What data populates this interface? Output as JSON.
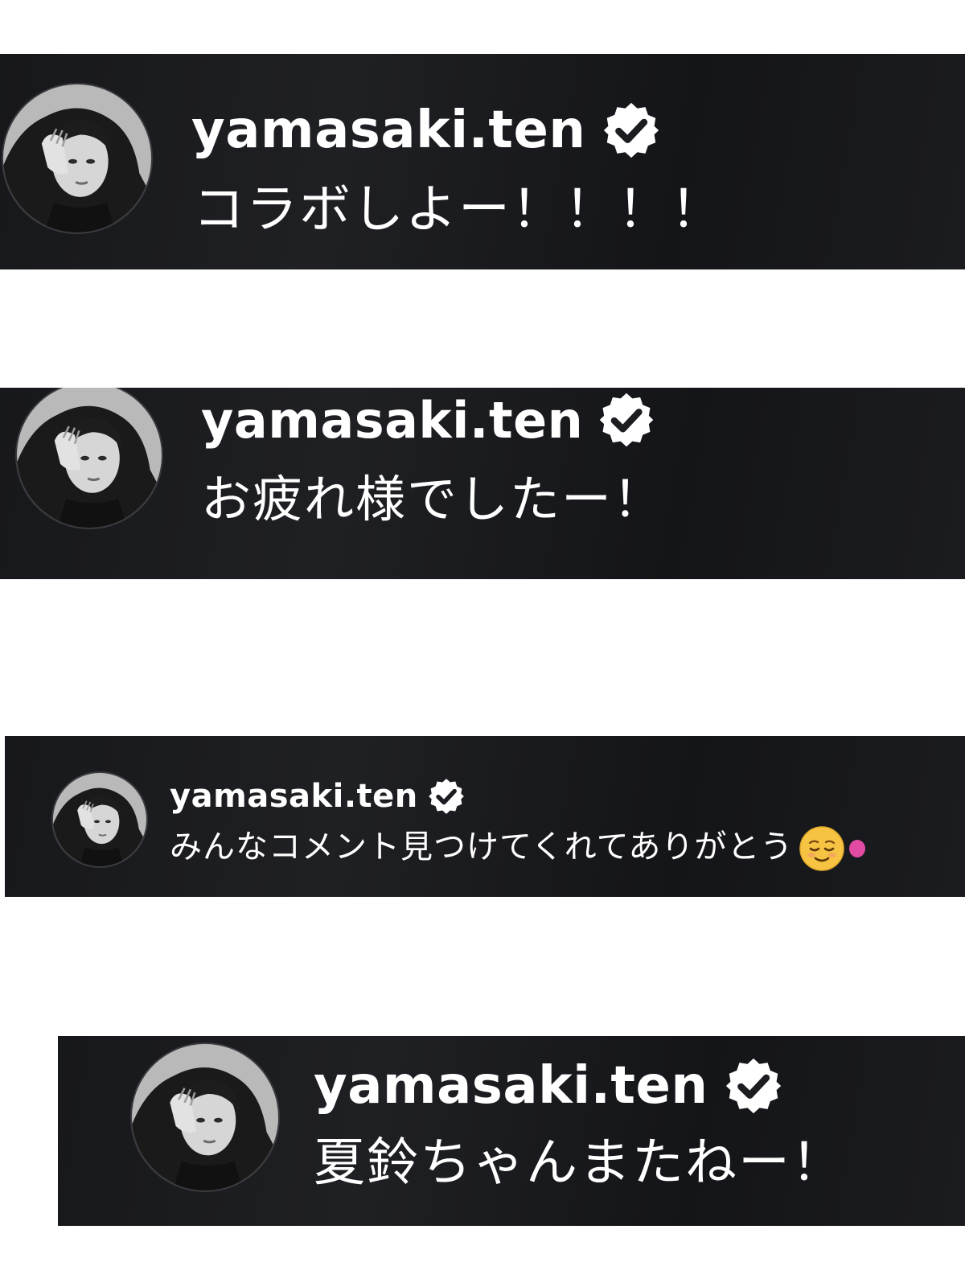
{
  "comments": [
    {
      "username": "yamasaki.ten",
      "verified": true,
      "text": "コラボしよー！！！！"
    },
    {
      "username": "yamasaki.ten",
      "verified": true,
      "text": "お疲れ様でしたー！"
    },
    {
      "username": "yamasaki.ten",
      "verified": true,
      "text": "みんなコメント見つけてくれてありがとう",
      "emoji": [
        "relieved-face-emoji",
        "pink-heart-emoji"
      ]
    },
    {
      "username": "yamasaki.ten",
      "verified": true,
      "text": "夏鈴ちゃんまたねー！"
    }
  ],
  "colors": {
    "card_background": "#1c1d21",
    "text": "#ffffff",
    "page_background": "#ffffff"
  }
}
